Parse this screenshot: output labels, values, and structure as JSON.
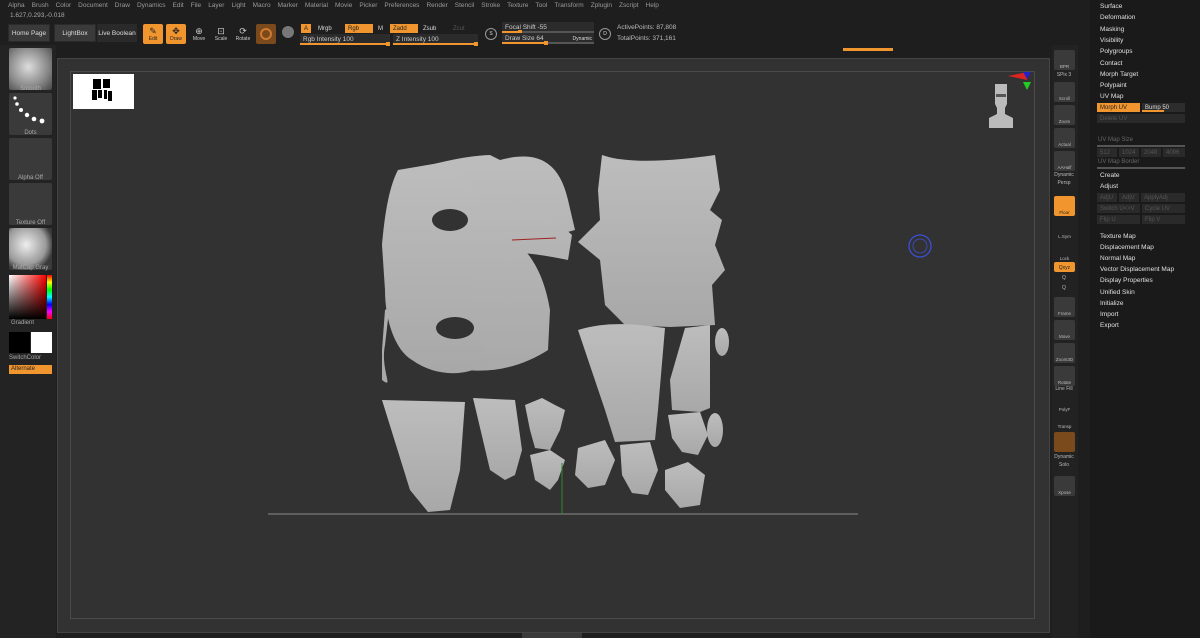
{
  "menu": [
    "Alpha",
    "Brush",
    "Color",
    "Document",
    "Draw",
    "Dynamics",
    "Edit",
    "File",
    "Layer",
    "Light",
    "Macro",
    "Marker",
    "Material",
    "Movie",
    "Picker",
    "Preferences",
    "Render",
    "Stencil",
    "Stroke",
    "Texture",
    "Tool",
    "Transform",
    "Zplugin",
    "Zscript",
    "Help"
  ],
  "coords": "1.627,0.293,-0.018",
  "top": {
    "home": "Home Page",
    "lightbox": "LightBox",
    "boolean": "Live Boolean"
  },
  "tools": [
    "Edit",
    "Draw",
    "Move",
    "Scale",
    "Rotate"
  ],
  "mtags": {
    "a": "A",
    "mrgb": "Mrgb",
    "rgb": "Rgb",
    "m": "M",
    "zadd": "Zadd",
    "zsub": "Zsub",
    "zcut": "Zcut"
  },
  "sliders": {
    "rgb_intensity": "Rgb Intensity 100",
    "z_intensity": "Z Intensity 100",
    "focal_shift": "Focal Shift -55",
    "draw_size": "Draw Size 64",
    "dynamic": "Dynamic"
  },
  "levels": {
    "rgb_intensity": 1.0,
    "z_intensity": 1.0,
    "focal_shift": 0.22,
    "draw_size": 0.5
  },
  "rounds": {
    "s": "S",
    "d": "D"
  },
  "stats": {
    "active": "ActivePoints: 87,808",
    "total": "TotalPoints: 371,161"
  },
  "left": {
    "smooth": "Smooth",
    "dots": "Dots",
    "alpha": "Alpha Off",
    "texture": "Texture Off",
    "matcap": "MatCap Gray",
    "gradient": "Gradient",
    "switchcolor": "SwitchColor",
    "alternate": "Alternate"
  },
  "right": {
    "bpr": "BPR",
    "spix": "SPix 3",
    "scroll": "Scroll",
    "zoom": "Zoom",
    "actual": "Actual",
    "aahalf": "AAHalf",
    "dynamic": "Dynamic",
    "persp": "Persp",
    "floor": "Floor",
    "lsym": "L.Sym",
    "lock": "Lock",
    "xyz": "Qxyz",
    "q1": "Q",
    "q2": "Q",
    "frame": "Frame",
    "move": "Move",
    "zoom3d": "Zoom3D",
    "rotate": "Rotate",
    "linefill": "Line Fill",
    "polyf": "PolyF",
    "transp": "Transp",
    "dynamic2": "Dynamic",
    "solo": "Solo",
    "xpose": "Xpose"
  },
  "panel": {
    "surface": "Surface",
    "deformation": "Deformation",
    "masking": "Masking",
    "visibility": "Visibility",
    "polygroups": "Polygroups",
    "contact": "Contact",
    "morph_target": "Morph Target",
    "polypaint": "Polypaint",
    "uv_map": "UV Map",
    "morph_uv": "Morph UV",
    "bump": "Bump 50",
    "delete_uv": "Delete UV",
    "uv_map_size": "UV Map Size",
    "size_512": "512",
    "size_1024": "1024",
    "size_2048": "2048",
    "size_4096": "4096",
    "uv_map_border": "UV Map Border",
    "create": "Create",
    "adjust": "Adjust",
    "adju": "AdjU",
    "adjv": "AdjV",
    "applyadj": "ApplyAdj",
    "switch_uv": "Switch U<>V",
    "cycle_uv": "Cycle UV",
    "flip_u": "Flip U",
    "flip_v": "Flip V",
    "texture_map": "Texture Map",
    "displacement_map": "Displacement Map",
    "normal_map": "Normal Map",
    "vector_displacement_map": "Vector Displacement Map",
    "display_properties": "Display Properties",
    "unified_skin": "Unified Skin",
    "initialize": "Initialize",
    "import": "Import",
    "export": "Export"
  },
  "colors": {
    "accent": "#f1962e",
    "bg": "#1e1e1e",
    "canvas": "#323232"
  }
}
